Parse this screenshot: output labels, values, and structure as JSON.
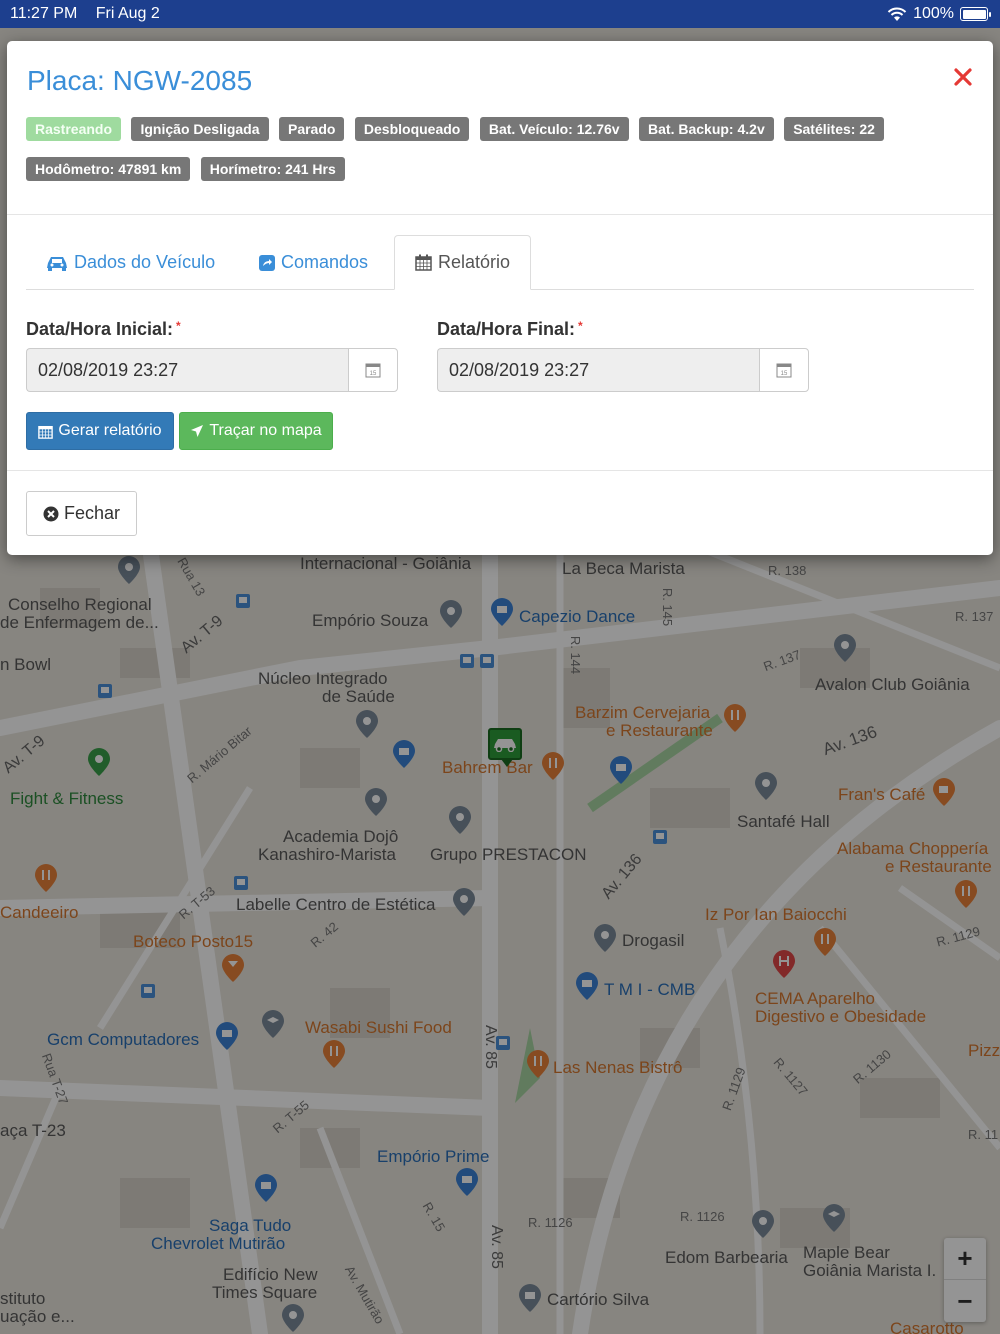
{
  "status_bar": {
    "time": "11:27 PM",
    "date": "Fri Aug 2",
    "battery": "100%"
  },
  "modal": {
    "title": "Placa: NGW-2085",
    "badges": [
      {
        "label": "Rastreando",
        "variant": "success"
      },
      {
        "label": "Ignição Desligada",
        "variant": "default"
      },
      {
        "label": "Parado",
        "variant": "default"
      },
      {
        "label": "Desbloqueado",
        "variant": "default"
      },
      {
        "label": "Bat. Veículo: 12.76v",
        "variant": "default"
      },
      {
        "label": "Bat. Backup: 4.2v",
        "variant": "default"
      },
      {
        "label": "Satélites: 22",
        "variant": "default"
      },
      {
        "label": "Hodômetro: 47891 km",
        "variant": "default"
      },
      {
        "label": "Horímetro: 241 Hrs",
        "variant": "default"
      }
    ],
    "tabs": {
      "vehicle_data": "Dados do Veículo",
      "commands": "Comandos",
      "report": "Relatório"
    },
    "form": {
      "start_label": "Data/Hora Inicial:",
      "start_value": "02/08/2019 23:27",
      "end_label": "Data/Hora Final:",
      "end_value": "02/08/2019 23:27",
      "required_mark": "*"
    },
    "buttons": {
      "generate_report": "Gerar relatório",
      "plot_on_map": "Traçar no mapa",
      "close": "Fechar"
    }
  },
  "map": {
    "labels": [
      "Internacional - Goiânia",
      "La Beca Marista",
      "Conselho Regional",
      "de Enfermagem de...",
      "Empório Souza",
      "Capezio Dance",
      "n Bowl",
      "Núcleo Integrado",
      "de Saúde",
      "Avalon Club Goiânia",
      "Barzim Cervejaria",
      "e Restaurante",
      "Bahrem Bar",
      "Fight & Fitness",
      "Fran's Café",
      "Santafé Hall",
      "Academia Dojô",
      "Kanashiro-Marista",
      "Grupo PRESTACON",
      "Alabama Choppería",
      "e Restaurante",
      "Candeeiro",
      "Labelle Centro de Estética",
      "Iz Por Ian Baiocchi",
      "Boteco Posto15",
      "Drogasil",
      "T M I - CMB",
      "CEMA Aparelho",
      "Digestivo e Obesidade",
      "Gcm Computadores",
      "Wasabi Sushi Food",
      "Las Nenas Bistrô",
      "aça T-23",
      "Empório Prime",
      "Saga Tudo",
      "Chevrolet Mutirão",
      "Edom Barbearia",
      "Maple Bear",
      "Goiânia Marista I.",
      "Edifício New",
      "Times Square",
      "Cartório Silva",
      "stituto",
      "uação e...",
      "Pizz",
      "Casarotto"
    ],
    "streets": [
      "Rua 13",
      "Av. T-9",
      "R. 138",
      "R. 137",
      "R. 145",
      "R. 144",
      "R. 137",
      "Av. 136",
      "R. Mário Bitar",
      "Av. T-9",
      "R. T-53",
      "R. 42",
      "Av. 136",
      "R. 1129",
      "Rua T-27",
      "Av. 85",
      "R. T-55",
      "R. 1129",
      "R. 1127",
      "R. 1130",
      "R. 15",
      "R. 1126",
      "R. 1126",
      "Av. 85",
      "Av. Mutirão",
      "R. 11"
    ],
    "zoom_in": "+",
    "zoom_out": "−"
  }
}
